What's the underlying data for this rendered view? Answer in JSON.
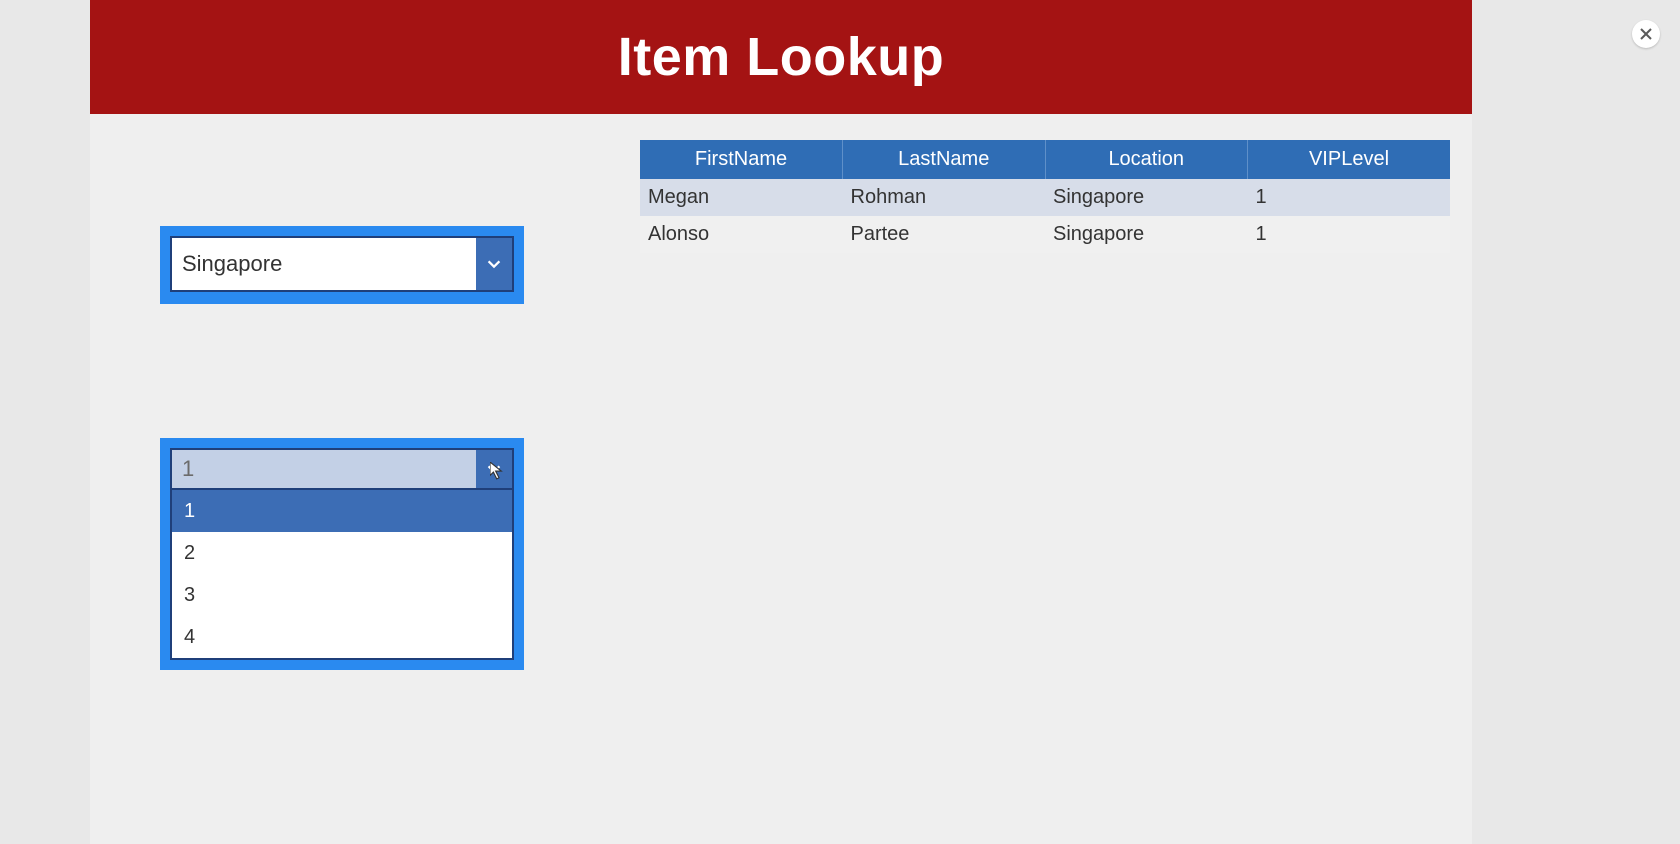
{
  "title": "Item Lookup",
  "close_icon_name": "close-icon",
  "dropdowns": {
    "location": {
      "selected": "Singapore"
    },
    "viplevel": {
      "selected": "1",
      "options": [
        "1",
        "2",
        "3",
        "4"
      ],
      "selected_index": 0
    }
  },
  "table": {
    "headers": [
      "FirstName",
      "LastName",
      "Location",
      "VIPLevel"
    ],
    "rows": [
      {
        "first": "Megan",
        "last": "Rohman",
        "loc": "Singapore",
        "vip": "1"
      },
      {
        "first": "Alonso",
        "last": "Partee",
        "loc": "Singapore",
        "vip": "1"
      }
    ]
  }
}
